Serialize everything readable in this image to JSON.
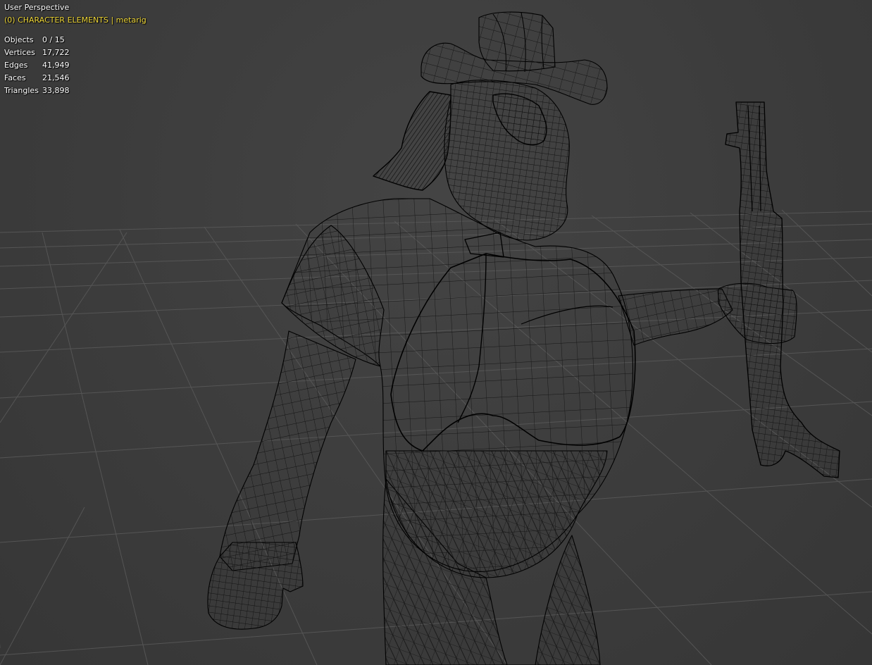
{
  "viewport": {
    "title": "User Perspective",
    "collection": "(0) CHARACTER ELEMENTS | metarig",
    "colors": {
      "background": "#3d3d3d",
      "grid_line": "#5a5a5a",
      "wire": "#000000",
      "text": "#ffffff",
      "collection_text": "#f0d83a"
    }
  },
  "stats": [
    {
      "label": "Objects",
      "value": "0 / 15"
    },
    {
      "label": "Vertices",
      "value": "17,722"
    },
    {
      "label": "Edges",
      "value": "41,949"
    },
    {
      "label": "Faces",
      "value": "21,546"
    },
    {
      "label": "Triangles",
      "value": "33,898"
    }
  ]
}
